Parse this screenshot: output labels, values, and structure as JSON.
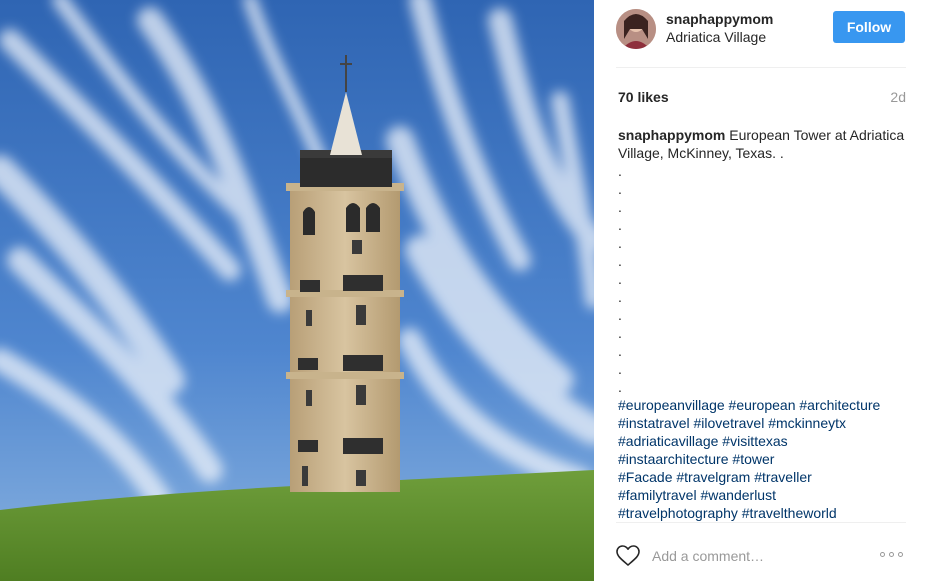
{
  "post": {
    "image_alt": "Bell tower on grassy hill under a blue sky with wispy clouds"
  },
  "header": {
    "username": "snaphappymom",
    "location": "Adriatica Village",
    "follow_label": "Follow"
  },
  "stats": {
    "likes": "70 likes",
    "time_ago": "2d"
  },
  "caption": {
    "username": "snaphappymom",
    "text": "European Tower at Adriatica Village, McKinney, Texas. .",
    "dots": [
      ".",
      ".",
      ".",
      ".",
      ".",
      ".",
      ".",
      ".",
      ".",
      ".",
      ".",
      ".",
      "."
    ],
    "hashtag_lines": [
      [
        "#europeanvillage",
        "#european",
        "#architecture"
      ],
      [
        "#instatravel",
        "#ilovetravel",
        "#mckinneytx"
      ],
      [
        "#adriaticavillage",
        "#visittexas"
      ],
      [
        "#instaarchitecture",
        "#tower"
      ],
      [
        "#Facade",
        "#travelgram",
        "#traveller"
      ],
      [
        "#familytravel",
        "#wanderlust"
      ],
      [
        "#travelphotography",
        "#traveltheworld"
      ]
    ]
  },
  "comment_box": {
    "placeholder": "Add a comment…"
  },
  "icons": {
    "like": "heart-outline-icon",
    "more": "more-options-icon"
  },
  "colors": {
    "follow_button": "#3897f0",
    "hashtag": "#003569",
    "muted": "#999999",
    "text": "#262626"
  }
}
